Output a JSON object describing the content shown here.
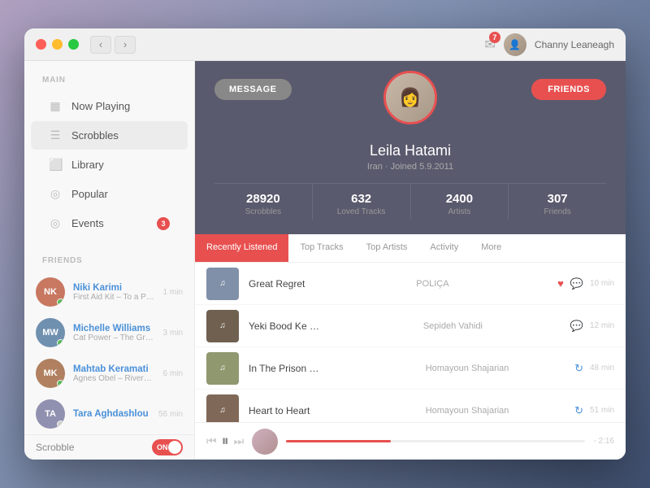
{
  "window": {
    "traffic_lights": [
      "red",
      "yellow",
      "green"
    ],
    "nav_back": "‹",
    "nav_forward": "›",
    "notification_count": "7",
    "user_name": "Channy Leaneagh"
  },
  "sidebar": {
    "main_label": "MAIN",
    "items": [
      {
        "id": "now-playing",
        "icon": "▦",
        "label": "Now Playing",
        "active": false
      },
      {
        "id": "scrobbles",
        "icon": "☰",
        "label": "Scrobbles",
        "active": true
      },
      {
        "id": "library",
        "icon": "⬜",
        "label": "Library",
        "active": false
      },
      {
        "id": "popular",
        "icon": "◎",
        "label": "Popular",
        "active": false
      },
      {
        "id": "events",
        "icon": "◎",
        "label": "Events",
        "badge": "3",
        "active": false
      }
    ],
    "friends_label": "FRIENDS",
    "friends": [
      {
        "name": "Niki Karimi",
        "track": "First Aid Kit – To a Poet",
        "time": "1 min",
        "color": "#c87860",
        "status": "#5cb85c"
      },
      {
        "name": "Michelle Williams",
        "track": "Cat Power – The Greatest",
        "time": "3 min",
        "color": "#7090b0",
        "status": "#5cb85c"
      },
      {
        "name": "Mahtab Keramati",
        "track": "Agnes Obel – Riverside",
        "time": "6 min",
        "color": "#b08060",
        "status": "#5cb85c"
      },
      {
        "name": "Tara Aghdashlou",
        "track": "",
        "time": "56 min",
        "color": "#9090b0",
        "status": "#cccccc"
      }
    ],
    "scrobble_label": "Scrobble",
    "toggle_text": "ON"
  },
  "profile": {
    "message_btn": "MESSAGE",
    "friends_btn": "FRIENDS",
    "name": "Leila Hatami",
    "sub": "Iran · Joined 5.9.2011",
    "stats": [
      {
        "num": "28920",
        "label": "Scrobbles"
      },
      {
        "num": "632",
        "label": "Loved Tracks"
      },
      {
        "num": "2400",
        "label": "Artists"
      },
      {
        "num": "307",
        "label": "Friends"
      }
    ]
  },
  "tabs": [
    {
      "label": "Recently Listened",
      "active": true
    },
    {
      "label": "Top Tracks",
      "active": false
    },
    {
      "label": "Top Artists",
      "active": false
    },
    {
      "label": "Activity",
      "active": false
    },
    {
      "label": "More",
      "active": false
    }
  ],
  "tracks": [
    {
      "title": "Great Regret",
      "artist": "POLIÇA",
      "time": "10 min",
      "heart": true,
      "chat": true,
      "refresh": false,
      "bg": "#8090a8"
    },
    {
      "title": "Yeki Bood Ke …",
      "artist": "Sepideh Vahidi",
      "time": "12 min",
      "heart": false,
      "chat": true,
      "refresh": false,
      "bg": "#706050"
    },
    {
      "title": "In The Prison …",
      "artist": "Homayoun Shajarian",
      "time": "48 min",
      "heart": false,
      "chat": false,
      "refresh": true,
      "bg": "#909870"
    },
    {
      "title": "Heart to Heart",
      "artist": "Homayoun Shajarian",
      "time": "51 min",
      "heart": false,
      "chat": false,
      "refresh": true,
      "bg": "#806858"
    }
  ],
  "player": {
    "progress_pct": "35",
    "time_remaining": "- 2:16"
  }
}
